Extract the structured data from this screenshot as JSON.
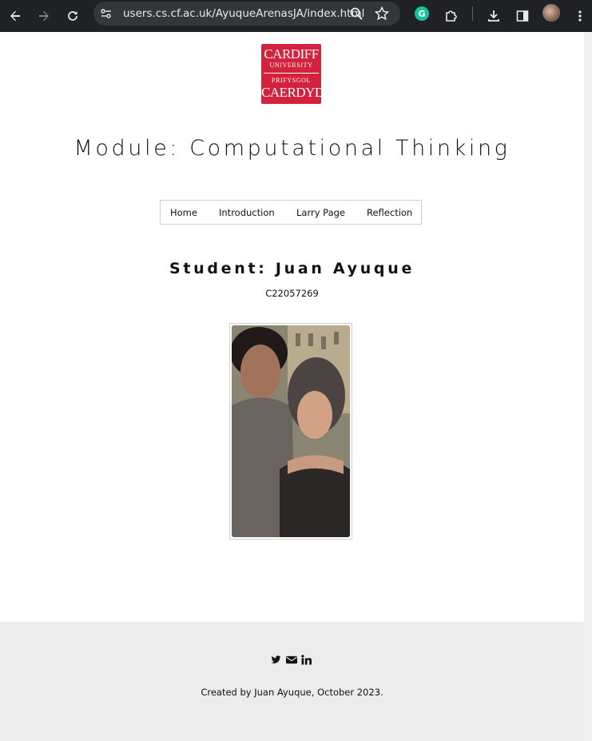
{
  "browser": {
    "url": "users.cs.cf.ac.uk/AyuqueArenasJA/index.html",
    "extension_badge": "G"
  },
  "logo": {
    "line1": "CARDIFF",
    "line2": "UNIVERSITY",
    "line3": "PRIFYSGOL",
    "line4": "CAERDYD"
  },
  "header": {
    "title": "Module: Computational Thinking"
  },
  "nav": {
    "items": [
      {
        "label": "Home"
      },
      {
        "label": "Introduction"
      },
      {
        "label": "Larry Page"
      },
      {
        "label": "Reflection"
      }
    ]
  },
  "main": {
    "student": "Student: Juan Ayuque",
    "student_id": "C22057269"
  },
  "footer": {
    "social_icons": [
      "twitter-icon",
      "mail-icon",
      "linkedin-icon"
    ],
    "credit": "Created by Juan Ayuque, October 2023."
  },
  "colors": {
    "brand_red": "#d4213d",
    "chrome_bg": "#202124",
    "footer_bg": "#ececec"
  }
}
